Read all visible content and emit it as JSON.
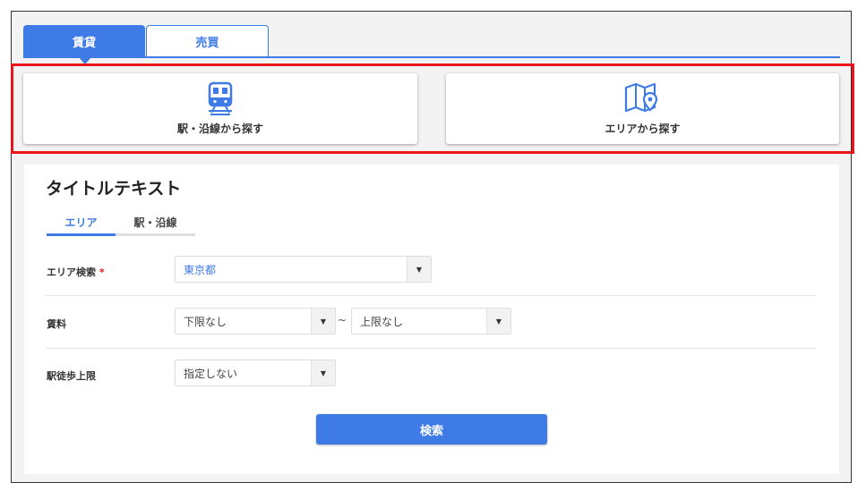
{
  "tabs": [
    {
      "label": "賃貸",
      "active": true
    },
    {
      "label": "売買",
      "active": false
    }
  ],
  "search_cards": [
    {
      "label": "駅・沿線から探す",
      "icon": "train-icon"
    },
    {
      "label": "エリアから探す",
      "icon": "map-pin-icon"
    }
  ],
  "section": {
    "title": "タイトルテキスト",
    "subtabs": [
      {
        "label": "エリア",
        "active": true
      },
      {
        "label": "駅・沿線",
        "active": false
      }
    ]
  },
  "form": {
    "area": {
      "label": "エリア検索",
      "required_mark": "*",
      "value": "東京都"
    },
    "rent": {
      "label": "賃料",
      "min_value": "下限なし",
      "separator": "~",
      "max_value": "上限なし"
    },
    "walk": {
      "label": "駅徒歩上限",
      "value": "指定しない"
    },
    "submit_label": "検索"
  },
  "colors": {
    "accent": "#3f7be6",
    "highlight": "#e8151b"
  }
}
